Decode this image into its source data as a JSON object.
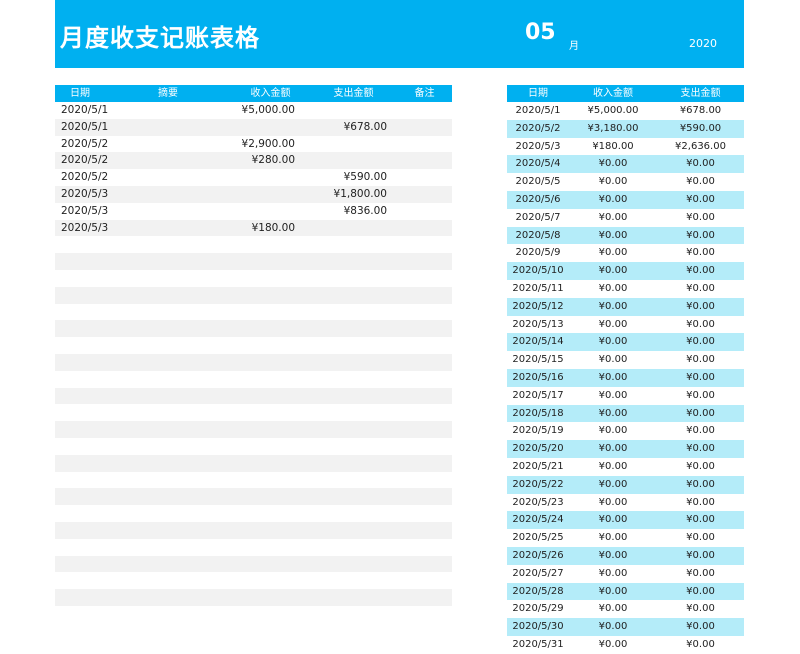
{
  "banner": {
    "title": "月度收支记账表格",
    "month": "05",
    "month_unit": "月",
    "year": "2020"
  },
  "ledger": {
    "headers": [
      "日期",
      "摘要",
      "收入金额",
      "支出金额",
      "备注"
    ],
    "rows": [
      {
        "date": "2020/5/1",
        "summary": "",
        "income": "¥5,000.00",
        "expense": "",
        "note": ""
      },
      {
        "date": "2020/5/1",
        "summary": "",
        "income": "",
        "expense": "¥678.00",
        "note": ""
      },
      {
        "date": "2020/5/2",
        "summary": "",
        "income": "¥2,900.00",
        "expense": "",
        "note": ""
      },
      {
        "date": "2020/5/2",
        "summary": "",
        "income": "¥280.00",
        "expense": "",
        "note": ""
      },
      {
        "date": "2020/5/2",
        "summary": "",
        "income": "",
        "expense": "¥590.00",
        "note": ""
      },
      {
        "date": "2020/5/3",
        "summary": "",
        "income": "",
        "expense": "¥1,800.00",
        "note": ""
      },
      {
        "date": "2020/5/3",
        "summary": "",
        "income": "",
        "expense": "¥836.00",
        "note": ""
      },
      {
        "date": "2020/5/3",
        "summary": "",
        "income": "¥180.00",
        "expense": "",
        "note": ""
      }
    ],
    "empty_rows": 23
  },
  "daily": {
    "headers": [
      "日期",
      "收入金额",
      "支出金额"
    ],
    "rows": [
      {
        "date": "2020/5/1",
        "income": "¥5,000.00",
        "expense": "¥678.00"
      },
      {
        "date": "2020/5/2",
        "income": "¥3,180.00",
        "expense": "¥590.00"
      },
      {
        "date": "2020/5/3",
        "income": "¥180.00",
        "expense": "¥2,636.00"
      },
      {
        "date": "2020/5/4",
        "income": "¥0.00",
        "expense": "¥0.00"
      },
      {
        "date": "2020/5/5",
        "income": "¥0.00",
        "expense": "¥0.00"
      },
      {
        "date": "2020/5/6",
        "income": "¥0.00",
        "expense": "¥0.00"
      },
      {
        "date": "2020/5/7",
        "income": "¥0.00",
        "expense": "¥0.00"
      },
      {
        "date": "2020/5/8",
        "income": "¥0.00",
        "expense": "¥0.00"
      },
      {
        "date": "2020/5/9",
        "income": "¥0.00",
        "expense": "¥0.00"
      },
      {
        "date": "2020/5/10",
        "income": "¥0.00",
        "expense": "¥0.00"
      },
      {
        "date": "2020/5/11",
        "income": "¥0.00",
        "expense": "¥0.00"
      },
      {
        "date": "2020/5/12",
        "income": "¥0.00",
        "expense": "¥0.00"
      },
      {
        "date": "2020/5/13",
        "income": "¥0.00",
        "expense": "¥0.00"
      },
      {
        "date": "2020/5/14",
        "income": "¥0.00",
        "expense": "¥0.00"
      },
      {
        "date": "2020/5/15",
        "income": "¥0.00",
        "expense": "¥0.00"
      },
      {
        "date": "2020/5/16",
        "income": "¥0.00",
        "expense": "¥0.00"
      },
      {
        "date": "2020/5/17",
        "income": "¥0.00",
        "expense": "¥0.00"
      },
      {
        "date": "2020/5/18",
        "income": "¥0.00",
        "expense": "¥0.00"
      },
      {
        "date": "2020/5/19",
        "income": "¥0.00",
        "expense": "¥0.00"
      },
      {
        "date": "2020/5/20",
        "income": "¥0.00",
        "expense": "¥0.00"
      },
      {
        "date": "2020/5/21",
        "income": "¥0.00",
        "expense": "¥0.00"
      },
      {
        "date": "2020/5/22",
        "income": "¥0.00",
        "expense": "¥0.00"
      },
      {
        "date": "2020/5/23",
        "income": "¥0.00",
        "expense": "¥0.00"
      },
      {
        "date": "2020/5/24",
        "income": "¥0.00",
        "expense": "¥0.00"
      },
      {
        "date": "2020/5/25",
        "income": "¥0.00",
        "expense": "¥0.00"
      },
      {
        "date": "2020/5/26",
        "income": "¥0.00",
        "expense": "¥0.00"
      },
      {
        "date": "2020/5/27",
        "income": "¥0.00",
        "expense": "¥0.00"
      },
      {
        "date": "2020/5/28",
        "income": "¥0.00",
        "expense": "¥0.00"
      },
      {
        "date": "2020/5/29",
        "income": "¥0.00",
        "expense": "¥0.00"
      },
      {
        "date": "2020/5/30",
        "income": "¥0.00",
        "expense": "¥0.00"
      },
      {
        "date": "2020/5/31",
        "income": "¥0.00",
        "expense": "¥0.00"
      }
    ]
  },
  "colors": {
    "accent": "#00b0f0",
    "stripe_blue": "#b4ecf9",
    "stripe_gray": "#f2f2f2"
  }
}
